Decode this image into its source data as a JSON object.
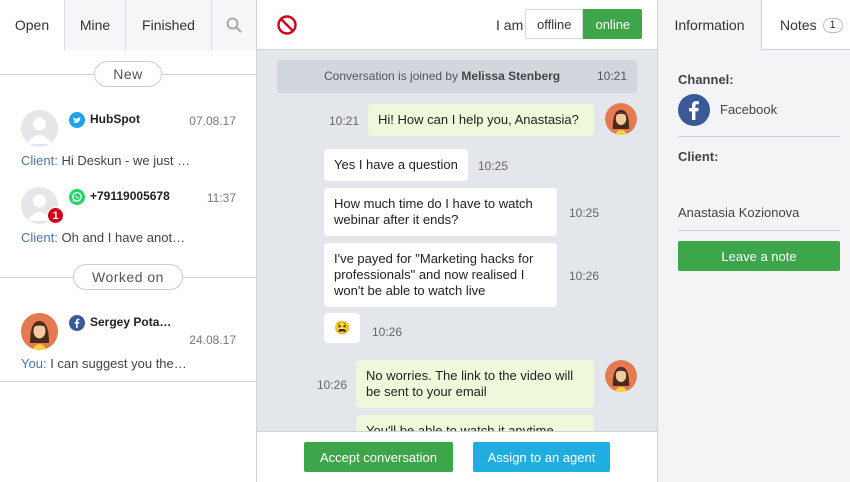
{
  "left_panel": {
    "tabs": [
      {
        "label": "Open",
        "active": true
      },
      {
        "label": "Mine",
        "active": false
      },
      {
        "label": "Finished",
        "active": false
      }
    ],
    "search_icon": "search-icon",
    "sections": {
      "new_label": "New",
      "worked_on_label": "Worked on"
    },
    "conversations": [
      {
        "channel": "twitter",
        "name": "HubSpot",
        "date": "07.08.17",
        "who": "Client:",
        "preview": "Hi Deskun - we just …",
        "unread": ""
      },
      {
        "channel": "whatsapp",
        "name": "+79119005678",
        "date": "11:37",
        "who": "Client:",
        "preview": "Oh and I have anot…",
        "unread": "1"
      },
      {
        "channel": "facebook",
        "name": "Sergey Pota…",
        "date": "24.08.17",
        "who": "You:",
        "preview": "I can suggest you the…",
        "unread": ""
      }
    ]
  },
  "middle_panel": {
    "block_icon": "block-icon",
    "iam_label": "I am",
    "status_offline": "offline",
    "status_online": "online",
    "joined": {
      "prefix": "Conversation is joined by",
      "agent": "Melissa Stenberg",
      "time": "10:21"
    },
    "messages": [
      {
        "from": "agent",
        "text": "Hi! How can I help you, Anastasia?",
        "time": "10:21"
      },
      {
        "from": "client",
        "text": "Yes I have a question",
        "time": "10:25"
      },
      {
        "from": "client",
        "lines": [
          "How much time do I have to watch",
          "webinar after it ends?"
        ],
        "time": "10:25"
      },
      {
        "from": "client",
        "lines": [
          "I've payed for \"Marketing hacks for",
          "professionals\" and now realised I",
          "won't be able to watch live"
        ],
        "time": "10:26"
      },
      {
        "from": "client",
        "text": "😫",
        "time": "10:26"
      },
      {
        "from": "agent",
        "lines": [
          "No worries. The link to the video will",
          "be sent to your email"
        ],
        "time": "10:26"
      },
      {
        "from": "agent",
        "text": "You'll be able to watch it anytime",
        "time": ""
      }
    ],
    "accept_button": "Accept conversation",
    "assign_button": "Assign to an agent"
  },
  "right_panel": {
    "tab_information": "Information",
    "tab_notes": "Notes",
    "notes_count": "1",
    "channel_label": "Channel:",
    "channel_value": "Facebook",
    "client_label": "Client:",
    "client_name": "Anastasia Kozionova",
    "leave_note_button": "Leave a note"
  },
  "colors": {
    "green": "#3da64b",
    "blue": "#20aee0",
    "agent_bubble": "#eef9dc",
    "chat_bg": "#e3e6ea",
    "facebook": "#3b5998",
    "twitter": "#1da1f2",
    "whatsapp": "#25d366",
    "unread_badge": "#d0021b",
    "block_icon": "#d0021b"
  }
}
